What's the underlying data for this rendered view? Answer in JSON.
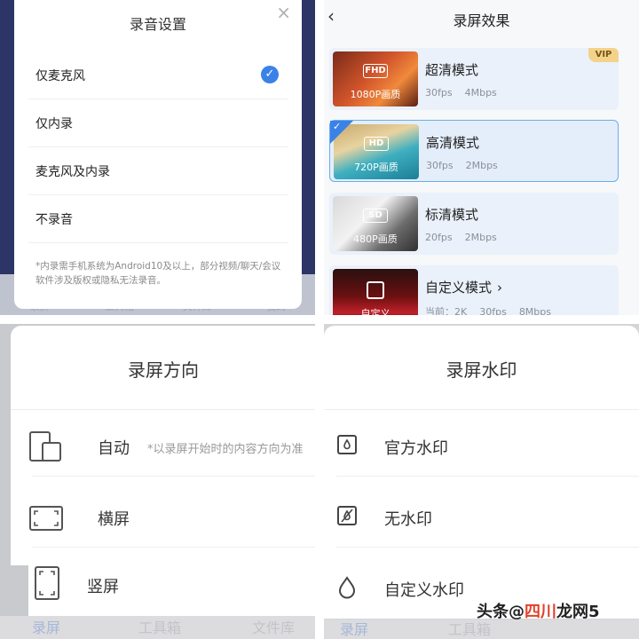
{
  "audio_settings": {
    "title": "录音设置",
    "options": [
      {
        "label": "仅麦克风",
        "selected": true
      },
      {
        "label": "仅内录",
        "selected": false
      },
      {
        "label": "麦克风及内录",
        "selected": false
      },
      {
        "label": "不录音",
        "selected": false
      }
    ],
    "note": "*内录需手机系统为Android10及以上，部分视频/聊天/会议软件涉及版权或隐私无法录音。",
    "bottom_tabs": [
      "录屏",
      "工具箱",
      "文件库",
      "我的"
    ]
  },
  "record_quality": {
    "title": "录屏效果",
    "modes": [
      {
        "name": "超清模式",
        "badge": "FHD",
        "resolution_label": "1080P画质",
        "fps": "30fps",
        "bitrate": "4Mbps",
        "vip": "VIP",
        "selected": false
      },
      {
        "name": "高清模式",
        "badge": "HD",
        "resolution_label": "720P画质",
        "fps": "30fps",
        "bitrate": "2Mbps",
        "selected": true
      },
      {
        "name": "标清模式",
        "badge": "SD",
        "resolution_label": "480P画质",
        "fps": "20fps",
        "bitrate": "2Mbps",
        "selected": false
      },
      {
        "name": "自定义模式",
        "resolution_label": "自定义",
        "current_prefix": "当前：2K",
        "fps": "30fps",
        "bitrate": "8Mbps",
        "selected": false
      }
    ]
  },
  "orientation": {
    "title": "录屏方向",
    "options": [
      {
        "label": "自动",
        "hint": "*以录屏开始时的内容方向为准"
      },
      {
        "label": "横屏"
      },
      {
        "label": "竖屏"
      }
    ],
    "bottom_tabs": [
      "录屏",
      "工具箱",
      "文件库"
    ]
  },
  "watermark": {
    "title": "录屏水印",
    "options": [
      {
        "label": "官方水印"
      },
      {
        "label": "无水印"
      },
      {
        "label": "自定义水印"
      }
    ],
    "bottom_tabs": [
      "录屏",
      "工具箱"
    ],
    "attribution": {
      "prefix": "头条",
      "at": "@",
      "accent": "四川",
      "suffix": "龙网5"
    }
  },
  "colors": {
    "accent_blue": "#3b82e8",
    "selected_border": "#6aaee8",
    "vip_gold": "#f3d38a",
    "dark_backdrop": "#2c3565"
  }
}
